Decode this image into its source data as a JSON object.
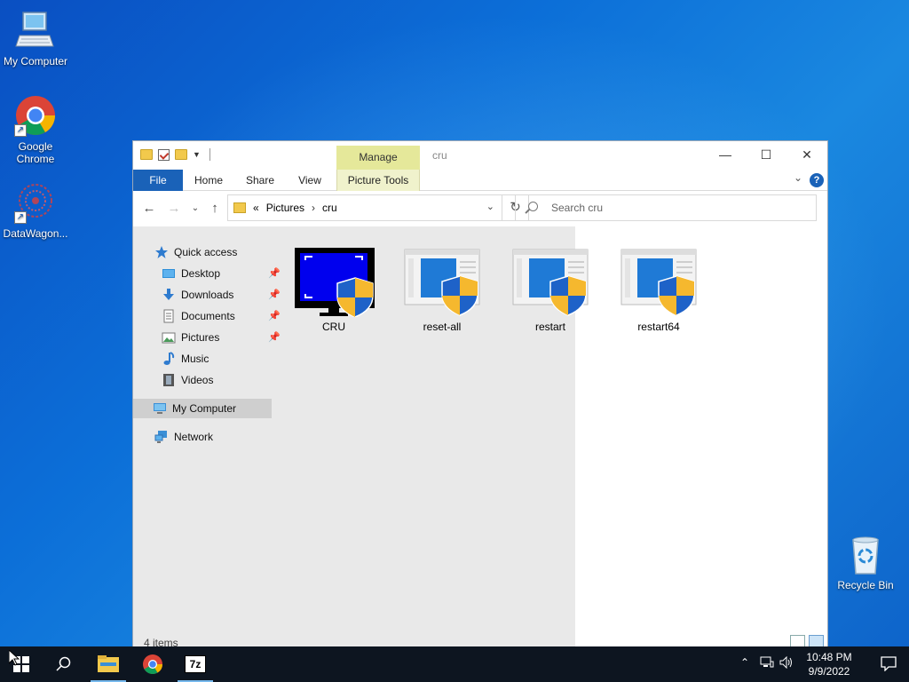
{
  "desktop": {
    "icons": [
      {
        "label": "My Computer",
        "icon": "computer-icon"
      },
      {
        "label": "Google Chrome",
        "icon": "chrome-icon"
      },
      {
        "label": "DataWagon...",
        "icon": "datawagon-icon"
      }
    ],
    "recycle_bin": {
      "label": "Recycle Bin",
      "icon": "recycle-bin-icon"
    }
  },
  "window": {
    "title": "cru",
    "contextual_tab": "Manage",
    "ribbon_tabs": [
      "File",
      "Home",
      "Share",
      "View",
      "Picture Tools"
    ],
    "help": "?",
    "address": {
      "overflow": "«",
      "crumbs": [
        "Pictures",
        "cru"
      ]
    },
    "search": {
      "placeholder": "Search cru"
    },
    "nav_pane": {
      "quick_access": "Quick access",
      "items": [
        {
          "label": "Desktop",
          "icon": "desktop-icon",
          "pinned": true
        },
        {
          "label": "Downloads",
          "icon": "downloads-icon",
          "pinned": true
        },
        {
          "label": "Documents",
          "icon": "documents-icon",
          "pinned": true
        },
        {
          "label": "Pictures",
          "icon": "pictures-icon",
          "pinned": true
        },
        {
          "label": "Music",
          "icon": "music-icon",
          "pinned": false
        },
        {
          "label": "Videos",
          "icon": "videos-icon",
          "pinned": false
        }
      ],
      "my_computer": "My Computer",
      "network": "Network"
    },
    "files": [
      {
        "name": "CRU",
        "icon": "cru-app-icon"
      },
      {
        "name": "reset-all",
        "icon": "uac-file-icon"
      },
      {
        "name": "restart",
        "icon": "uac-file-icon"
      },
      {
        "name": "restart64",
        "icon": "uac-file-icon"
      }
    ],
    "status": "4 items"
  },
  "taskbar": {
    "clock": {
      "time": "10:48 PM",
      "date": "9/9/2022"
    },
    "pinned": [
      "start-icon",
      "search-icon",
      "file-explorer-icon",
      "chrome-icon",
      "7zip-icon"
    ],
    "seven_zip_label": "7z"
  },
  "colors": {
    "accent": "#1a62b8",
    "manage_tab": "#e5e89a",
    "desktop": "#0c6fd8"
  }
}
